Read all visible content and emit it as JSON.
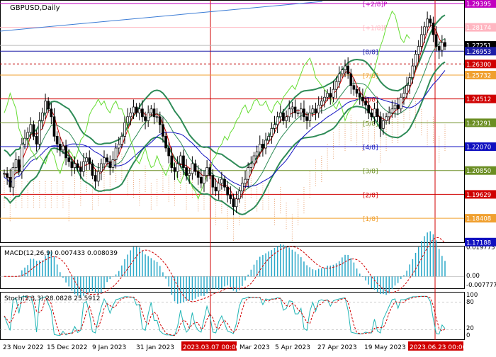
{
  "chart_data": {
    "type": "candlestick",
    "symbol_label": "GBPUSD,Daily",
    "price_axis": {
      "range": [
        1.1718,
        1.2939
      ],
      "tick_labels": [
        {
          "value": 1.29395,
          "text": "1.29395",
          "color": "#c000c0"
        },
        {
          "value": 1.28174,
          "text": "1.28174",
          "color": "#ffb6c1"
        },
        {
          "value": 1.27251,
          "text": "1.27251",
          "color": "#ffffff"
        },
        {
          "value": 1.26953,
          "text": "1.26953",
          "color": "#1f1fa8"
        },
        {
          "value": 1.263,
          "text": "1.26300",
          "color": "#d00000"
        },
        {
          "value": 1.25732,
          "text": "1.25732",
          "color": "#f0a030"
        },
        {
          "value": 1.24512,
          "text": "1.24512",
          "color": "#d00000"
        },
        {
          "value": 1.23291,
          "text": "1.23291",
          "color": "#6b8e23"
        },
        {
          "value": 1.2207,
          "text": "1.22070",
          "color": "#1010c0"
        },
        {
          "value": 1.2085,
          "text": "1.20850",
          "color": "#6b8e23"
        },
        {
          "value": 1.19629,
          "text": "1.19629",
          "color": "#d00000"
        },
        {
          "value": 1.18408,
          "text": "1.18408",
          "color": "#f0a030"
        },
        {
          "value": 1.17188,
          "text": "1.17188",
          "color": "#1010c0"
        }
      ]
    },
    "murrey_levels": [
      {
        "label": "[+2/8]P",
        "value": 1.29395,
        "color": "#c000c0"
      },
      {
        "label": "[+1/8]P",
        "value": 1.28174,
        "color": "#ffb6c1"
      },
      {
        "label": "[8/8]",
        "value": 1.26953,
        "color": "#1f1fa8"
      },
      {
        "label": "[7/8]",
        "value": 1.25732,
        "color": "#f0a030"
      },
      {
        "label": "[6/8]",
        "value": 1.24512,
        "color": "#d00000"
      },
      {
        "label": "[5/8]",
        "value": 1.23291,
        "color": "#6b8e23"
      },
      {
        "label": "[4/8]",
        "value": 1.2207,
        "color": "#1010c0"
      },
      {
        "label": "[3/8]",
        "value": 1.2085,
        "color": "#6b8e23"
      },
      {
        "label": "[2/8]",
        "value": 1.19629,
        "color": "#d00000"
      },
      {
        "label": "[1/8]",
        "value": 1.18408,
        "color": "#f0a030"
      }
    ],
    "dashed_level": 1.263,
    "current_price": 1.27251,
    "x_axis_labels": [
      "23 Nov 2022",
      "15 Dec 2022",
      "9 Jan 2023",
      "31 Jan 2023",
      "2023.03.07 00:00",
      "Mar 2023",
      "5 Apr 2023",
      "27 Apr 2023",
      "19 May 2023",
      "2023.06.23 00:00"
    ],
    "vertical_markers": [
      "2023.03.07 00:00",
      "2023.06.23 00:00"
    ],
    "close_path": [
      1.207,
      1.205,
      1.2,
      1.21,
      1.214,
      1.208,
      1.222,
      1.225,
      1.228,
      1.232,
      1.226,
      1.222,
      1.234,
      1.238,
      1.244,
      1.24,
      1.236,
      1.226,
      1.222,
      1.219,
      1.221,
      1.215,
      1.213,
      1.21,
      1.212,
      1.21,
      1.208,
      1.213,
      1.215,
      1.212,
      1.206,
      1.203,
      1.208,
      1.212,
      1.215,
      1.213,
      1.21,
      1.214,
      1.22,
      1.222,
      1.226,
      1.233,
      1.236,
      1.238,
      1.241,
      1.238,
      1.24,
      1.236,
      1.234,
      1.238,
      1.24,
      1.236,
      1.236,
      1.232,
      1.226,
      1.22,
      1.216,
      1.21,
      1.208,
      1.212,
      1.216,
      1.21,
      1.206,
      1.207,
      1.212,
      1.208,
      1.205,
      1.202,
      1.206,
      1.21,
      1.206,
      1.2,
      1.198,
      1.202,
      1.204,
      1.2,
      1.196,
      1.194,
      1.19,
      1.194,
      1.198,
      1.202,
      1.204,
      1.21,
      1.212,
      1.216,
      1.218,
      1.222,
      1.22,
      1.224,
      1.226,
      1.23,
      1.232,
      1.236,
      1.238,
      1.234,
      1.236,
      1.24,
      1.241,
      1.238,
      1.238,
      1.24,
      1.236,
      1.234,
      1.238,
      1.24,
      1.238,
      1.242,
      1.244,
      1.246,
      1.248,
      1.246,
      1.25,
      1.254,
      1.258,
      1.26,
      1.262,
      1.258,
      1.252,
      1.25,
      1.248,
      1.246,
      1.244,
      1.242,
      1.238,
      1.236,
      1.24,
      1.236,
      1.23,
      1.234,
      1.236,
      1.238,
      1.24,
      1.242,
      1.24,
      1.246,
      1.248,
      1.252,
      1.256,
      1.262,
      1.268,
      1.272,
      1.278,
      1.282,
      1.286,
      1.284,
      1.278,
      1.272,
      1.27,
      1.274,
      1.272
    ],
    "indicators": {
      "macd": {
        "label": "MACD(12,26,9) 0.007433 0.008039",
        "scale_labels": [
          "0.019775",
          "0.00",
          "-0.007777"
        ],
        "range": [
          -0.007777,
          0.019775
        ]
      },
      "stochastic": {
        "label": "Stoch(5,3,3) 28.0828 25.5912",
        "scale_labels": [
          "100",
          "80",
          "20",
          "0"
        ],
        "range": [
          0,
          100
        ]
      }
    }
  }
}
